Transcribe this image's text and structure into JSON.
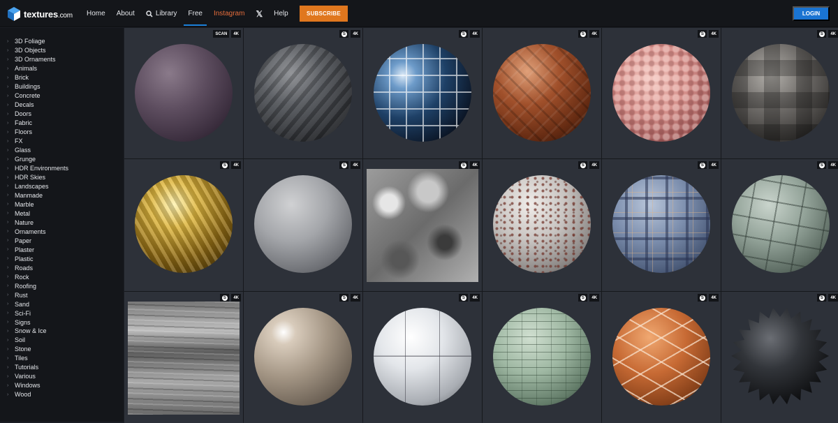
{
  "header": {
    "logo_text": "textures",
    "logo_tld": ".com",
    "nav": [
      {
        "label": "Home",
        "active": false
      },
      {
        "label": "About",
        "active": false
      },
      {
        "label": "Library",
        "active": false,
        "icon": "search-icon"
      },
      {
        "label": "Free",
        "active": true
      },
      {
        "label": "Instagram",
        "active": false
      },
      {
        "label": "𝕏",
        "active": false,
        "icon": "x-logo-icon"
      },
      {
        "label": "Help",
        "active": false
      }
    ],
    "subscribe_label": "SUBSCRIBE",
    "login_label": "LOGIN",
    "colors": {
      "subscribe": "#e0771e",
      "login": "#1a74d2",
      "instagram": "#e56d3c",
      "active_underline": "#1a7fd8"
    }
  },
  "sidebar": {
    "categories": [
      "3D Foliage",
      "3D Objects",
      "3D Ornaments",
      "Animals",
      "Brick",
      "Buildings",
      "Concrete",
      "Decals",
      "Doors",
      "Fabric",
      "Floors",
      "FX",
      "Glass",
      "Grunge",
      "HDR Environments",
      "HDR Skies",
      "Landscapes",
      "Manmade",
      "Marble",
      "Metal",
      "Nature",
      "Ornaments",
      "Paper",
      "Plaster",
      "Plastic",
      "Roads",
      "Rock",
      "Roofing",
      "Rust",
      "Sand",
      "Sci-Fi",
      "Signs",
      "Snow & Ice",
      "Soil",
      "Stone",
      "Tiles",
      "Tutorials",
      "Various",
      "Windows",
      "Wood"
    ]
  },
  "grid": {
    "s_icon_letter": "S",
    "tiles": [
      {
        "badges": [
          "SCAN",
          "4K"
        ],
        "has_s": false,
        "material": "m-purple",
        "shape": "sphere"
      },
      {
        "badges": [
          "4K"
        ],
        "has_s": true,
        "material": "m-rock",
        "shape": "sphere"
      },
      {
        "badges": [
          "4K"
        ],
        "has_s": true,
        "material": "m-glass",
        "shape": "sphere"
      },
      {
        "badges": [
          "4K"
        ],
        "has_s": true,
        "material": "m-parquet",
        "shape": "sphere"
      },
      {
        "badges": [
          "4K"
        ],
        "has_s": true,
        "material": "m-flesh",
        "shape": "sphere"
      },
      {
        "badges": [
          "4K"
        ],
        "has_s": true,
        "material": "m-tiles-pattern",
        "shape": "sphere"
      },
      {
        "badges": [
          "4K"
        ],
        "has_s": true,
        "material": "m-gold",
        "shape": "sphere"
      },
      {
        "badges": [
          "4K"
        ],
        "has_s": true,
        "material": "m-concrete",
        "shape": "sphere"
      },
      {
        "badges": [
          "4K"
        ],
        "has_s": true,
        "material": "m-stone-tex",
        "shape": "square"
      },
      {
        "badges": [
          "4K"
        ],
        "has_s": true,
        "material": "m-chipped",
        "shape": "sphere"
      },
      {
        "badges": [
          "4K"
        ],
        "has_s": true,
        "material": "m-plaid",
        "shape": "sphere"
      },
      {
        "badges": [
          "4K"
        ],
        "has_s": true,
        "material": "m-greenstone",
        "shape": "sphere"
      },
      {
        "badges": [
          "4K"
        ],
        "has_s": true,
        "material": "m-wood-tex",
        "shape": "square"
      },
      {
        "badges": [
          "4K"
        ],
        "has_s": true,
        "material": "m-beige",
        "shape": "sphere"
      },
      {
        "badges": [
          "4K"
        ],
        "has_s": true,
        "material": "m-white-panel",
        "shape": "sphere"
      },
      {
        "badges": [
          "4K"
        ],
        "has_s": true,
        "material": "m-greenbrick",
        "shape": "sphere"
      },
      {
        "badges": [
          "4K"
        ],
        "has_s": true,
        "material": "m-terracotta",
        "shape": "sphere"
      },
      {
        "badges": [
          "4K"
        ],
        "has_s": true,
        "material": "m-spiky",
        "shape": "spiky"
      }
    ]
  }
}
